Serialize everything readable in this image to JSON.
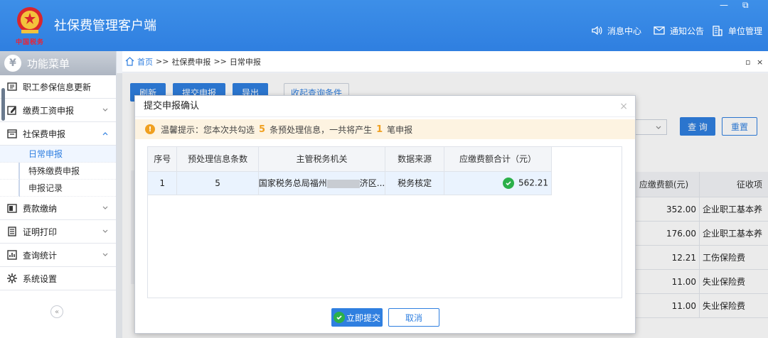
{
  "header": {
    "app_title": "社保费管理客户端",
    "logo_sub": "中国税务",
    "messages_label": "消息中心",
    "notice_label": "通知公告",
    "org_label": "单位管理",
    "window_minimize": "—",
    "window_restore": "⧉"
  },
  "sidebar": {
    "title": "功能菜单",
    "items": [
      {
        "label": "职工参保信息更新"
      },
      {
        "label": "缴费工资申报"
      },
      {
        "label": "社保费申报"
      },
      {
        "label": "费款缴纳"
      },
      {
        "label": "证明打印"
      },
      {
        "label": "查询统计"
      },
      {
        "label": "系统设置"
      }
    ],
    "sub_items": [
      {
        "label": "日常申报"
      },
      {
        "label": "特殊缴费申报"
      },
      {
        "label": "申报记录"
      }
    ],
    "collapse_label": "«"
  },
  "breadcrumb": {
    "home": "首页",
    "sep1": ">>",
    "level1": "社保费申报",
    "sep2": ">>",
    "level2": "日常申报",
    "ctrl_restore": "▫",
    "ctrl_close": "×"
  },
  "toolbar": {
    "refresh": "刷新",
    "submit": "提交申报",
    "export": "导出",
    "collapse_query": "收起查询条件",
    "query": "查 询",
    "reset": "重置"
  },
  "background_table": {
    "headers": {
      "amount": "应缴费额(元)",
      "type": "征收项"
    },
    "rows": [
      {
        "amount": "352.00",
        "type": "企业职工基本养"
      },
      {
        "amount": "176.00",
        "type": "企业职工基本养"
      },
      {
        "amount": "12.21",
        "type": "工伤保险费"
      },
      {
        "amount": "11.00",
        "type": "失业保险费"
      },
      {
        "amount": "11.00",
        "type": "失业保险费"
      }
    ]
  },
  "dialog": {
    "title": "提交申报确认",
    "close": "×",
    "tip": {
      "prefix": "温馨提示：您本次共勾选",
      "selected_count": "5",
      "middle": "条预处理信息，一共将产生",
      "report_count": "1",
      "suffix": "笔申报"
    },
    "columns": {
      "seq": "序号",
      "count": "预处理信息条数",
      "tax_office": "主管税务机关",
      "source": "数据来源",
      "total": "应缴费额合计（元）"
    },
    "rows": [
      {
        "seq": "1",
        "count": "5",
        "tax_office_a": "国家税务总局福州",
        "tax_office_b": "济区...",
        "source": "税务核定",
        "total": "562.21"
      }
    ],
    "submit_label": "立即提交",
    "cancel_label": "取消"
  }
}
